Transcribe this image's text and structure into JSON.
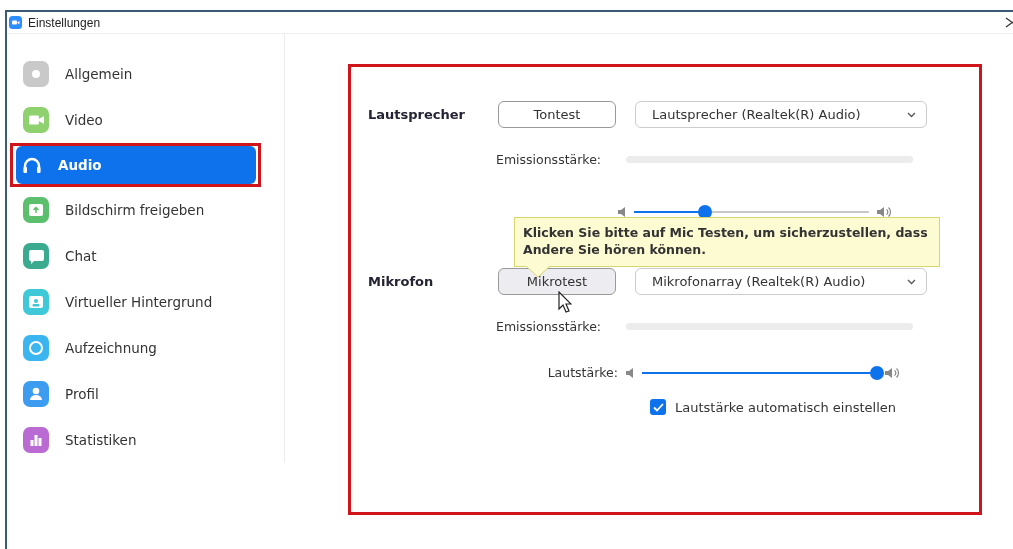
{
  "window": {
    "title": "Einstellungen"
  },
  "sidebar": {
    "items": [
      {
        "label": "Allgemein",
        "kind": "gear",
        "color": "#c9c9c9",
        "selected": false
      },
      {
        "label": "Video",
        "kind": "video",
        "color": "#8fd16f",
        "selected": false
      },
      {
        "label": "Audio",
        "kind": "headphones",
        "color": "#0e72ed",
        "selected": true
      },
      {
        "label": "Bildschirm freigeben",
        "kind": "share",
        "color": "#5cbf6e",
        "selected": false
      },
      {
        "label": "Chat",
        "kind": "chat",
        "color": "#3aab8f",
        "selected": false
      },
      {
        "label": "Virtueller Hintergrund",
        "kind": "background",
        "color": "#3fc8d8",
        "selected": false
      },
      {
        "label": "Aufzeichnung",
        "kind": "record",
        "color": "#3bb5f0",
        "selected": false
      },
      {
        "label": "Profil",
        "kind": "profile",
        "color": "#3b9cf0",
        "selected": false
      },
      {
        "label": "Statistiken",
        "kind": "stats",
        "color": "#b96ad3",
        "selected": false
      }
    ]
  },
  "speaker": {
    "label": "Lautsprecher",
    "test_button": {
      "label": "Tontest",
      "hovered": false
    },
    "device": "Lautsprecher (Realtek(R) Audio)",
    "output_level": {
      "label": "Emissionsstärke:",
      "level": 0
    },
    "volume": {
      "level": 0.3
    }
  },
  "tooltip": {
    "text": "Klicken Sie bitte auf Mic Testen, um sicherzustellen, dass Andere Sie hören können."
  },
  "microphone": {
    "label": "Mikrofon",
    "test_button": {
      "label": "Mikrotest",
      "hovered": true
    },
    "device": "Mikrofonarray (Realtek(R) Audio)",
    "output_level": {
      "label": "Emissionsstärke:",
      "level": 0
    },
    "volume": {
      "label": "Lautstärke:",
      "level": 1
    },
    "auto_volume": {
      "label": "Lautstärke automatisch einstellen",
      "checked": true
    }
  }
}
